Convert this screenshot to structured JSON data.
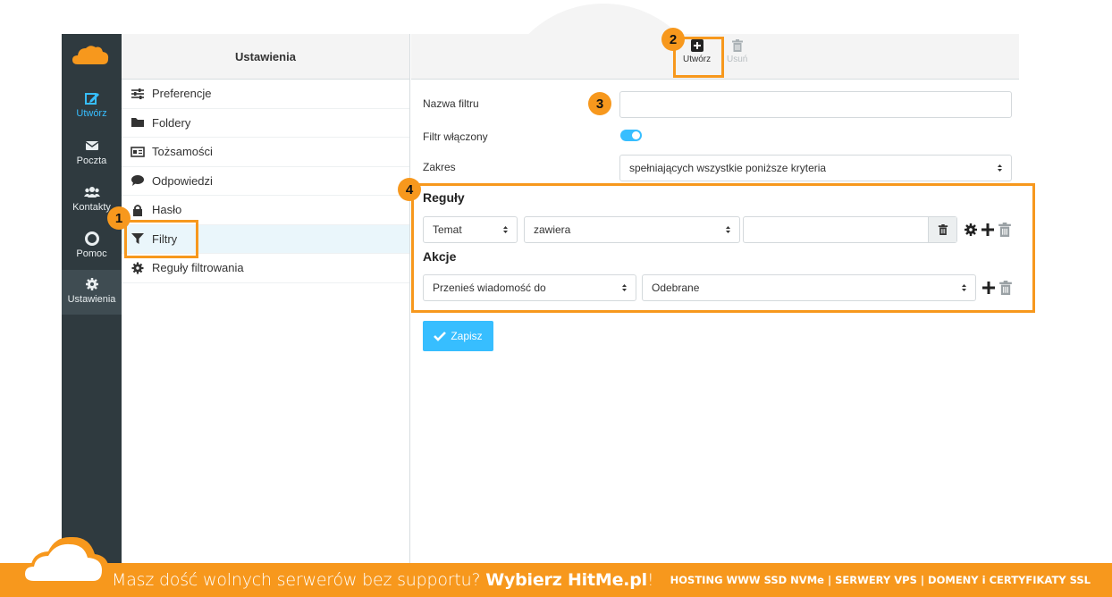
{
  "nav": {
    "items": [
      {
        "label": "Utwórz",
        "icon": "compose-icon"
      },
      {
        "label": "Poczta",
        "icon": "envelope-icon"
      },
      {
        "label": "Kontakty",
        "icon": "users-icon"
      },
      {
        "label": "Pomoc",
        "icon": "lifebuoy-icon"
      },
      {
        "label": "Ustawienia",
        "icon": "gear-icon"
      }
    ]
  },
  "settings": {
    "title": "Ustawienia",
    "items": [
      {
        "label": "Preferencje",
        "icon": "sliders-icon"
      },
      {
        "label": "Foldery",
        "icon": "folder-icon"
      },
      {
        "label": "Tożsamości",
        "icon": "id-card-icon"
      },
      {
        "label": "Odpowiedzi",
        "icon": "comment-icon"
      },
      {
        "label": "Hasło",
        "icon": "lock-icon"
      },
      {
        "label": "Filtry",
        "icon": "filter-icon"
      },
      {
        "label": "Reguły filtrowania",
        "icon": "gear-icon"
      }
    ]
  },
  "toolbar": {
    "create_label": "Utwórz",
    "delete_label": "Usuń"
  },
  "form": {
    "name_label": "Nazwa filtru",
    "name_value": "",
    "enabled_label": "Filtr włączony",
    "scope_label": "Zakres",
    "scope_value": "spełniających wszystkie poniższe kryteria",
    "rules_title": "Reguły",
    "rule_header": "Temat",
    "rule_op": "zawiera",
    "rule_value": "",
    "actions_title": "Akcje",
    "action_type": "Przenieś wiadomość do",
    "action_target": "Odebrane",
    "save_label": "Zapisz"
  },
  "badges": {
    "b1": "1",
    "b2": "2",
    "b3": "3",
    "b4": "4"
  },
  "banner": {
    "text_plain": "Masz dość wolnych serwerów bez supportu? ",
    "text_bold": "Wybierz HitMe.pl",
    "text_end": "!",
    "right": "HOSTING WWW SSD NVMe | SERWERY VPS | DOMENY i CERTYFIKATY SSL"
  },
  "colors": {
    "accent": "#37beff",
    "highlight": "#f7981d",
    "nav_bg": "#2f3a3f"
  }
}
